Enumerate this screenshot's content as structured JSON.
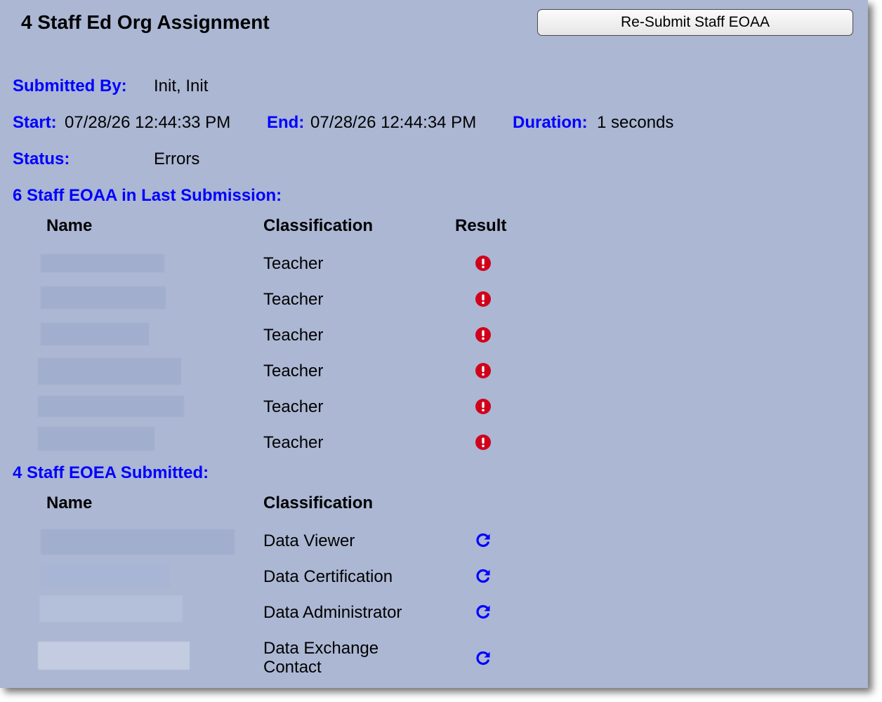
{
  "header": {
    "title": "4 Staff Ed Org Assignment",
    "resubmit_label": "Re-Submit Staff EOAA"
  },
  "summary": {
    "submitted_by_label": "Submitted By:",
    "submitted_by_value": "Init, Init",
    "start_label": "Start:",
    "start_value": "07/28/26 12:44:33 PM",
    "end_label": "End:",
    "end_value": "07/28/26 12:44:34 PM",
    "duration_label": "Duration:",
    "duration_value": "1 seconds",
    "status_label": "Status:",
    "status_value": "Errors"
  },
  "last_submission": {
    "heading": "6 Staff EOAA in Last Submission:",
    "columns": {
      "name": "Name",
      "classification": "Classification",
      "result": "Result"
    },
    "rows": [
      {
        "classification": "Teacher",
        "result_icon": "error-icon"
      },
      {
        "classification": "Teacher",
        "result_icon": "error-icon"
      },
      {
        "classification": "Teacher",
        "result_icon": "error-icon"
      },
      {
        "classification": "Teacher",
        "result_icon": "error-icon"
      },
      {
        "classification": "Teacher",
        "result_icon": "error-icon"
      },
      {
        "classification": "Teacher",
        "result_icon": "error-icon"
      }
    ]
  },
  "submitted": {
    "heading": "4 Staff EOEA Submitted:",
    "columns": {
      "name": "Name",
      "classification": "Classification"
    },
    "rows": [
      {
        "classification": "Data Viewer",
        "action_icon": "refresh-icon"
      },
      {
        "classification": "Data Certification",
        "action_icon": "refresh-icon"
      },
      {
        "classification": "Data Administrator",
        "action_icon": "refresh-icon"
      },
      {
        "classification_line1": "Data Exchange",
        "classification_line2": "Contact",
        "action_icon": "refresh-icon"
      }
    ]
  },
  "colors": {
    "panel_bg": "#abb7d3",
    "label_blue": "#0000ff",
    "error_red": "#d0021b",
    "icon_blue": "#0000ff"
  }
}
